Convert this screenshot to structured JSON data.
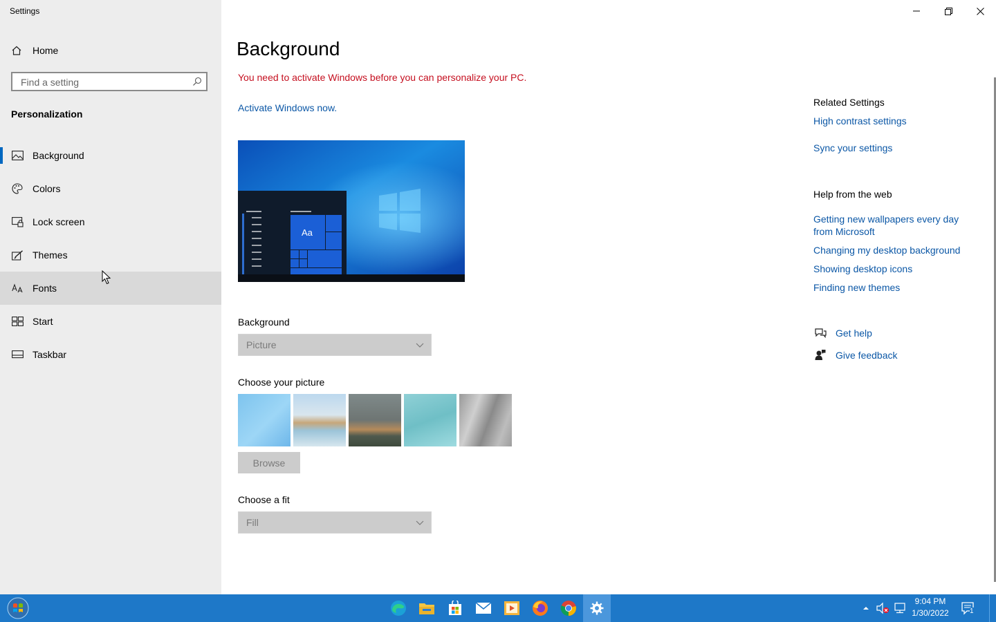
{
  "window": {
    "title": "Settings",
    "controls": {
      "minimize": "minimize",
      "restore": "restore",
      "close": "close"
    }
  },
  "sidebar": {
    "home_label": "Home",
    "search_placeholder": "Find a setting",
    "section_title": "Personalization",
    "items": [
      {
        "label": "Background",
        "icon": "picture-icon",
        "active": true
      },
      {
        "label": "Colors",
        "icon": "palette-icon"
      },
      {
        "label": "Lock screen",
        "icon": "lock-screen-icon"
      },
      {
        "label": "Themes",
        "icon": "brush-icon"
      },
      {
        "label": "Fonts",
        "icon": "font-icon",
        "hover": true
      },
      {
        "label": "Start",
        "icon": "start-grid-icon"
      },
      {
        "label": "Taskbar",
        "icon": "taskbar-icon"
      }
    ]
  },
  "main": {
    "title": "Background",
    "warning": "You need to activate Windows before you can personalize your PC.",
    "activate_link": "Activate Windows now.",
    "preview_tile_text": "Aa",
    "background_label": "Background",
    "background_value": "Picture",
    "choose_picture_label": "Choose your picture",
    "browse_label": "Browse",
    "fit_label": "Choose a fit",
    "fit_value": "Fill"
  },
  "related": {
    "title": "Related Settings",
    "links": [
      "High contrast settings",
      "Sync your settings"
    ],
    "help_title": "Help from the web",
    "help_links": [
      "Getting new wallpapers every day from Microsoft",
      "Changing my desktop background",
      "Showing desktop icons",
      "Finding new themes"
    ],
    "get_help": "Get help",
    "give_feedback": "Give feedback"
  },
  "taskbar": {
    "apps": [
      "edge-icon",
      "file-explorer-icon",
      "store-icon",
      "mail-icon",
      "media-player-icon",
      "firefox-icon",
      "chrome-icon",
      "settings-icon"
    ],
    "time": "9:04 PM",
    "date": "1/30/2022",
    "notification_count": "1"
  },
  "colors": {
    "accent": "#0067c0",
    "link": "#0b57a6",
    "warning": "#c50f1f",
    "taskbar": "#1e78c8"
  }
}
